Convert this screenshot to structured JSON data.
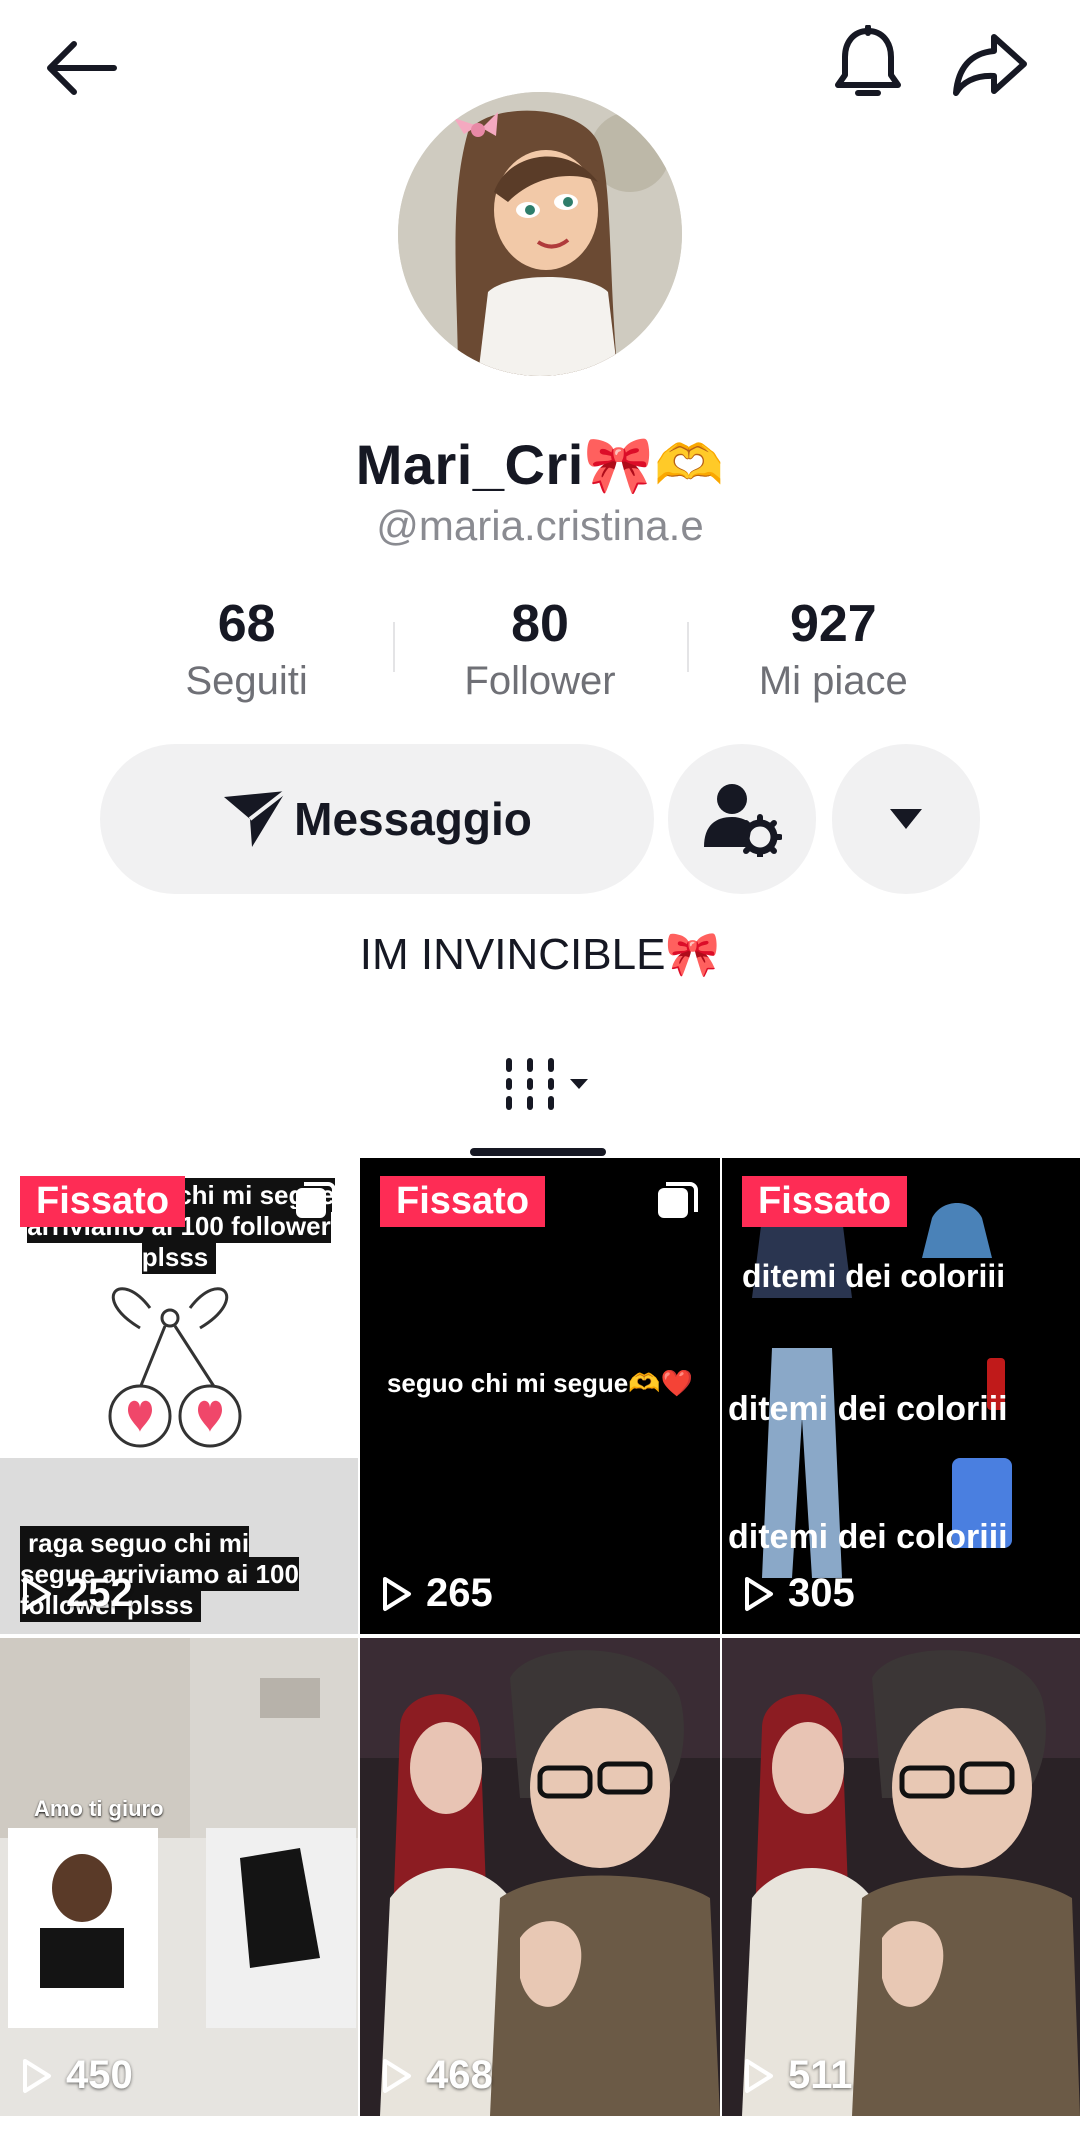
{
  "header": {
    "back_icon": "arrow-left-icon",
    "bell_icon": "bell-icon",
    "share_icon": "share-arrow-icon"
  },
  "profile": {
    "name": "Mari_Cri🎀🫶",
    "handle": "@maria.cristina.e",
    "bio": "IM INVINCIBLE🎀"
  },
  "stats": [
    {
      "value": "68",
      "label": "Seguiti"
    },
    {
      "value": "80",
      "label": "Follower"
    },
    {
      "value": "927",
      "label": "Mi piace"
    }
  ],
  "actions": {
    "message_label": "Messaggio",
    "message_icon": "paper-plane-icon",
    "friend_icon": "user-settings-icon",
    "more_icon": "caret-down-icon"
  },
  "tabs": {
    "grid_icon": "video-grid-icon"
  },
  "videos": [
    {
      "pinned": "Fissato",
      "views": "252",
      "caption_top": "raga seguo chi mi segue arriviamo ai 100 follower plsss",
      "caption_bottom": "raga seguo chi mi segue arriviamo ai 100 follower plsss"
    },
    {
      "pinned": "Fissato",
      "views": "265",
      "caption": "seguo chi mi segue🫶❤️"
    },
    {
      "pinned": "Fissato",
      "views": "305",
      "caption": "ditemi dei coloriii"
    },
    {
      "views": "450",
      "caption": "Amo ti giuro"
    },
    {
      "views": "468"
    },
    {
      "views": "511"
    }
  ],
  "colors": {
    "accent": "#fe2c55",
    "button_bg": "#f1f1f2",
    "text": "#161823",
    "muted": "#8a8b91"
  }
}
